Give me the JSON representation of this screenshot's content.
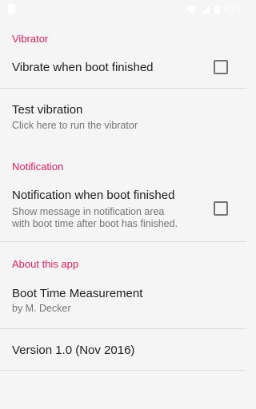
{
  "status_bar": {
    "time": "8:24",
    "icons": [
      "notification-icon",
      "wifi-icon",
      "signal-icon",
      "battery-icon"
    ]
  },
  "sections": {
    "vibrator": {
      "header": "Vibrator",
      "vibrate_when_boot": {
        "title": "Vibrate when boot finished",
        "checked": false
      },
      "test_vibration": {
        "title": "Test vibration",
        "summary": "Click here to run the vibrator"
      }
    },
    "notification": {
      "header": "Notification",
      "notify_when_boot": {
        "title": "Notification when boot finished",
        "summary_line1": "Show message in notification area",
        "summary_line2": "with boot time after boot has finished.",
        "checked": false
      }
    },
    "about": {
      "header": "About this app",
      "app_name": {
        "title": "Boot Time Measurement",
        "summary": "by M. Decker"
      },
      "version": {
        "title": "Version 1.0 (Nov 2016)"
      }
    }
  },
  "colors": {
    "accent": "#e91e63",
    "background": "#f5f5f5",
    "text_primary": "#212121",
    "text_secondary": "#757575"
  }
}
